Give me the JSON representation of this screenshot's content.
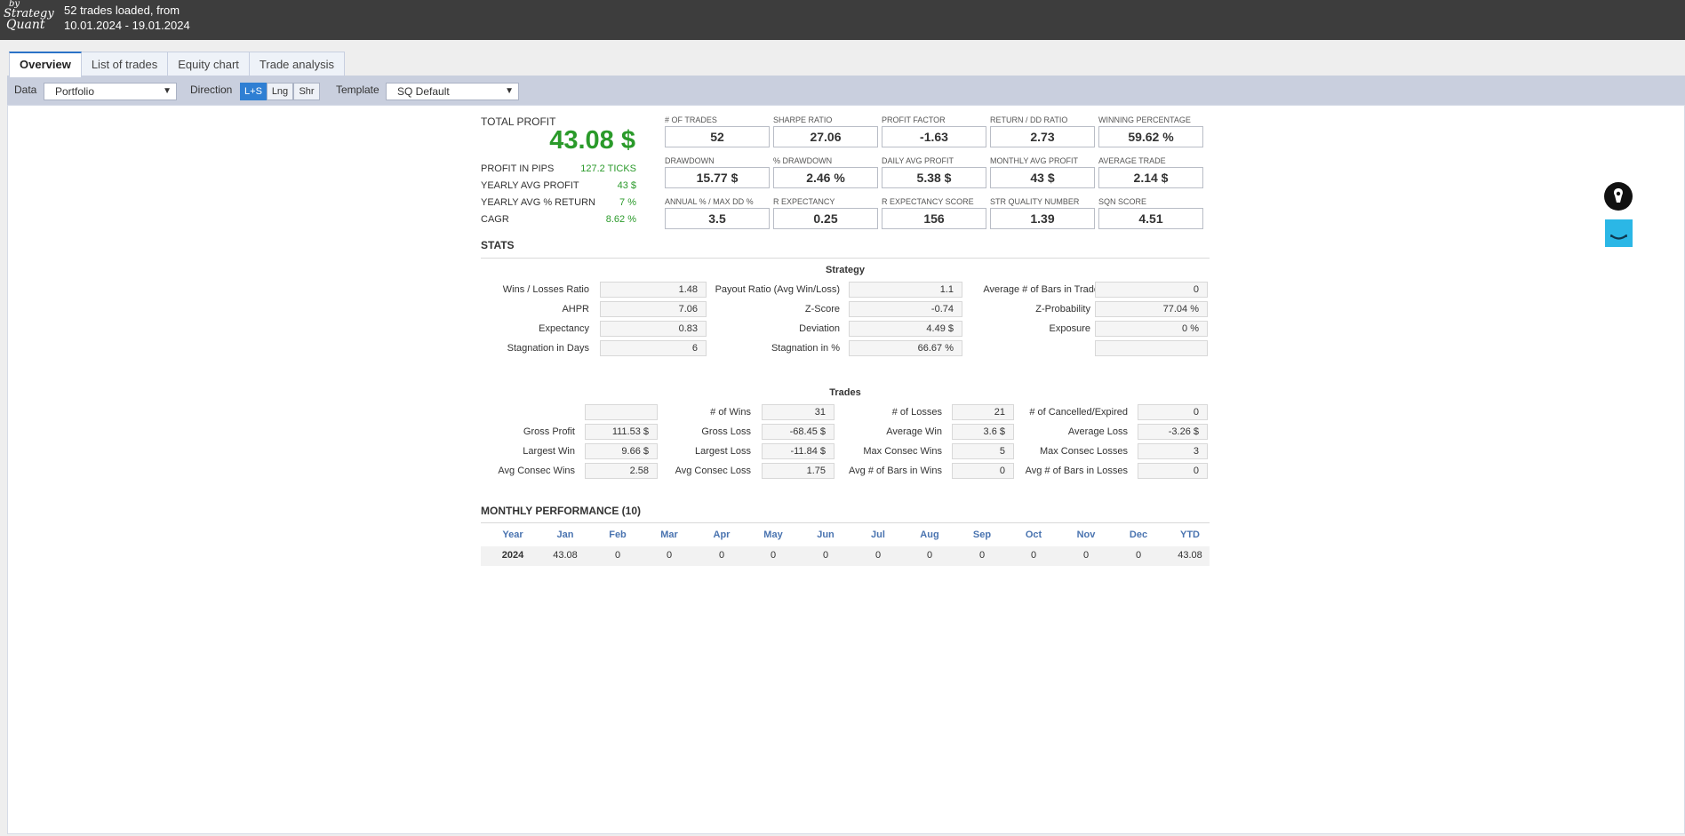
{
  "header": {
    "logo": {
      "by": "by",
      "line1": "Strategy",
      "line2": "Quant"
    },
    "load_line1": "52 trades loaded, from",
    "load_line2": "10.01.2024 - 19.01.2024"
  },
  "tabs": [
    {
      "label": "Overview",
      "active": true
    },
    {
      "label": "List of trades",
      "active": false
    },
    {
      "label": "Equity chart",
      "active": false
    },
    {
      "label": "Trade analysis",
      "active": false
    }
  ],
  "toolbar": {
    "data_label": "Data",
    "data_value": "Portfolio",
    "direction_label": "Direction",
    "direction_options": [
      "L+S",
      "Lng",
      "Shr"
    ],
    "direction_selected": "L+S",
    "template_label": "Template",
    "template_value": "SQ Default"
  },
  "summary": {
    "total_profit_label": "TOTAL PROFIT",
    "total_profit_value": "43.08 $",
    "rows": [
      {
        "label": "PROFIT IN PIPS",
        "value": "127.2 TICKS"
      },
      {
        "label": "YEARLY AVG PROFIT",
        "value": "43 $"
      },
      {
        "label": "YEARLY AVG % RETURN",
        "value": "7 %"
      },
      {
        "label": "CAGR",
        "value": "8.62 %"
      }
    ]
  },
  "kpis": [
    {
      "label": "# OF TRADES",
      "value": "52"
    },
    {
      "label": "SHARPE RATIO",
      "value": "27.06"
    },
    {
      "label": "PROFIT FACTOR",
      "value": "-1.63"
    },
    {
      "label": "RETURN / DD RATIO",
      "value": "2.73"
    },
    {
      "label": "WINNING PERCENTAGE",
      "value": "59.62 %"
    },
    {
      "label": "DRAWDOWN",
      "value": "15.77 $"
    },
    {
      "label": "% DRAWDOWN",
      "value": "2.46 %"
    },
    {
      "label": "DAILY AVG PROFIT",
      "value": "5.38 $"
    },
    {
      "label": "MONTHLY AVG PROFIT",
      "value": "43 $"
    },
    {
      "label": "AVERAGE TRADE",
      "value": "2.14 $"
    },
    {
      "label": "ANNUAL % / MAX DD %",
      "value": "3.5"
    },
    {
      "label": "R EXPECTANCY",
      "value": "0.25"
    },
    {
      "label": "R EXPECTANCY SCORE",
      "value": "156"
    },
    {
      "label": "STR QUALITY NUMBER",
      "value": "1.39"
    },
    {
      "label": "SQN SCORE",
      "value": "4.51"
    }
  ],
  "stats": {
    "title": "STATS",
    "strategy_title": "Strategy",
    "strategy": [
      [
        {
          "label": "Wins / Losses Ratio",
          "value": "1.48"
        },
        {
          "label": "Payout Ratio (Avg Win/Loss)",
          "value": "1.1"
        },
        {
          "label": "Average # of Bars in Trade",
          "value": "0"
        }
      ],
      [
        {
          "label": "AHPR",
          "value": "7.06"
        },
        {
          "label": "Z-Score",
          "value": "-0.74"
        },
        {
          "label": "Z-Probability",
          "value": "77.04 %"
        }
      ],
      [
        {
          "label": "Expectancy",
          "value": "0.83"
        },
        {
          "label": "Deviation",
          "value": "4.49 $"
        },
        {
          "label": "Exposure",
          "value": "0 %"
        }
      ],
      [
        {
          "label": "Stagnation in Days",
          "value": "6"
        },
        {
          "label": "Stagnation in %",
          "value": "66.67 %"
        },
        {
          "label": "",
          "value": ""
        }
      ]
    ],
    "trades_title": "Trades",
    "trades": [
      [
        {
          "label": "",
          "value": ""
        },
        {
          "label": "# of Wins",
          "value": "31"
        },
        {
          "label": "# of Losses",
          "value": "21"
        },
        {
          "label": "# of Cancelled/Expired",
          "value": "0"
        }
      ],
      [
        {
          "label": "Gross Profit",
          "value": "111.53 $"
        },
        {
          "label": "Gross Loss",
          "value": "-68.45 $"
        },
        {
          "label": "Average Win",
          "value": "3.6 $"
        },
        {
          "label": "Average Loss",
          "value": "-3.26 $"
        }
      ],
      [
        {
          "label": "Largest Win",
          "value": "9.66 $"
        },
        {
          "label": "Largest Loss",
          "value": "-11.84 $"
        },
        {
          "label": "Max Consec Wins",
          "value": "5"
        },
        {
          "label": "Max Consec Losses",
          "value": "3"
        }
      ],
      [
        {
          "label": "Avg Consec Wins",
          "value": "2.58"
        },
        {
          "label": "Avg Consec Loss",
          "value": "1.75"
        },
        {
          "label": "Avg # of Bars in Wins",
          "value": "0"
        },
        {
          "label": "Avg # of Bars in Losses",
          "value": "0"
        }
      ]
    ]
  },
  "monthly": {
    "title": "MONTHLY PERFORMANCE (10)",
    "headers": [
      "Year",
      "Jan",
      "Feb",
      "Mar",
      "Apr",
      "May",
      "Jun",
      "Jul",
      "Aug",
      "Sep",
      "Oct",
      "Nov",
      "Dec",
      "YTD"
    ],
    "rows": [
      [
        "2024",
        "43.08",
        "0",
        "0",
        "0",
        "0",
        "0",
        "0",
        "0",
        "0",
        "0",
        "0",
        "0",
        "43.08"
      ]
    ]
  },
  "side_icons": [
    "pen-nib-icon",
    "chat-widget-icon"
  ],
  "colors": {
    "topbar": "#3d3d3d",
    "accent": "#2f7fd3",
    "profit_green": "#2a9a2a",
    "toolbar": "#c9cfde"
  }
}
